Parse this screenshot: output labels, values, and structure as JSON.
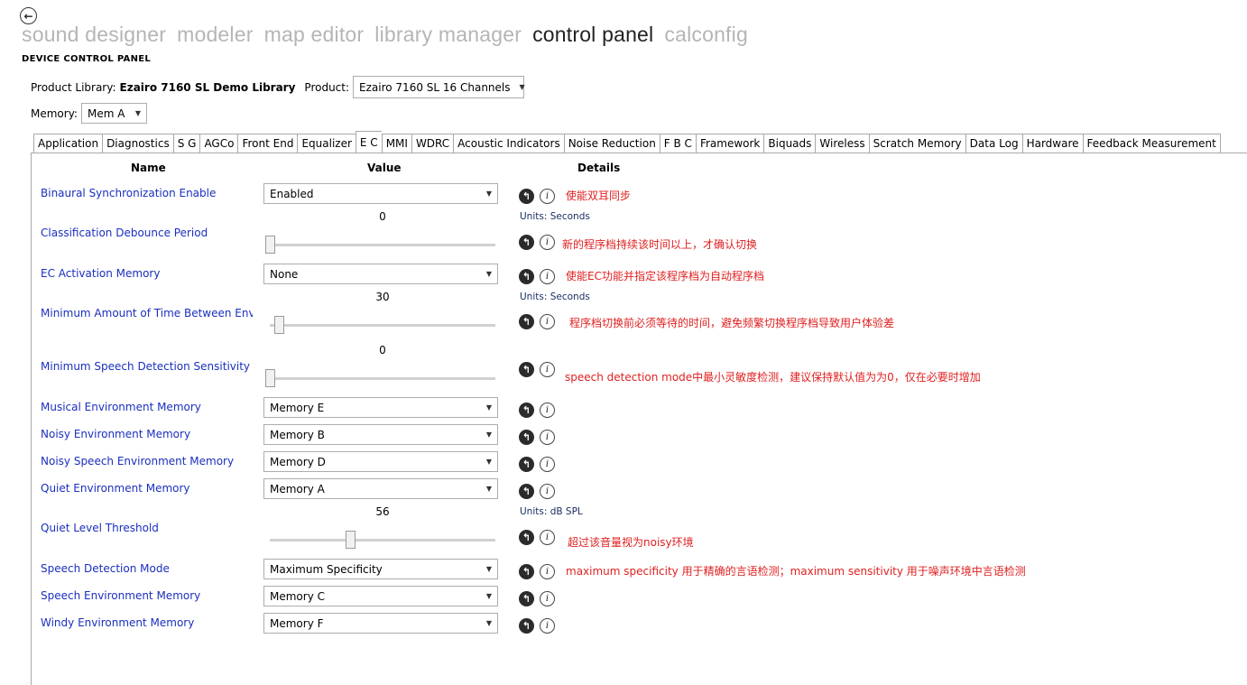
{
  "nav": {
    "back_icon": "back-arrow-icon",
    "items": [
      "sound designer",
      "modeler",
      "map editor",
      "library manager",
      "control panel",
      "calconfig"
    ],
    "active_index": 4
  },
  "page_title": "DEVICE CONTROL PANEL",
  "product_library": {
    "label": "Product Library:",
    "value": "Ezairo 7160 SL Demo Library"
  },
  "product": {
    "label": "Product:",
    "value": "Ezairo 7160 SL 16 Channels"
  },
  "memory": {
    "label": "Memory:",
    "value": "Mem A"
  },
  "tabs": [
    "Application",
    "Diagnostics",
    "S G",
    "AGCo",
    "Front End",
    "Equalizer",
    "E C",
    "MMI",
    "WDRC",
    "Acoustic Indicators",
    "Noise Reduction",
    "F B C",
    "Framework",
    "Biquads",
    "Wireless",
    "Scratch Memory",
    "Data Log",
    "Hardware",
    "Feedback Measurement"
  ],
  "active_tab": "E C",
  "columns": {
    "name": "Name",
    "value": "Value",
    "details": "Details"
  },
  "params": [
    {
      "name": "Binaural Synchronization Enable",
      "control": "dropdown",
      "value": "Enabled",
      "note": "使能双耳同步"
    },
    {
      "name": "Classification Debounce Period",
      "control": "slider",
      "value": "0",
      "units_label": "Units:",
      "units": "Seconds",
      "fraction": 0.0,
      "note": "新的程序档持续该时间以上，才确认切换"
    },
    {
      "name": "EC Activation Memory",
      "control": "dropdown",
      "value": "None",
      "note": "使能EC功能并指定该程序档为自动程序档"
    },
    {
      "name": "Minimum Amount of Time Between Envir",
      "control": "slider",
      "value": "30",
      "units_label": "Units:",
      "units": "Seconds",
      "fraction": 0.04,
      "note": "程序档切换前必须等待的时间，避免频繁切换程序档导致用户体验差"
    },
    {
      "name": "Minimum Speech Detection Sensitivity",
      "control": "slider",
      "value": "0",
      "fraction": 0.0,
      "note": "speech detection mode中最小灵敏度检测，建议保持默认值为为0，仅在必要时增加"
    },
    {
      "name": "Musical Environment Memory",
      "control": "dropdown",
      "value": "Memory E",
      "note": ""
    },
    {
      "name": "Noisy Environment Memory",
      "control": "dropdown",
      "value": "Memory B",
      "note": ""
    },
    {
      "name": "Noisy Speech Environment Memory",
      "control": "dropdown",
      "value": "Memory D",
      "note": ""
    },
    {
      "name": "Quiet Environment Memory",
      "control": "dropdown",
      "value": "Memory A",
      "note": ""
    },
    {
      "name": "Quiet Level Threshold",
      "control": "slider",
      "value": "56",
      "units_label": "Units:",
      "units": "dB SPL",
      "fraction": 0.356,
      "note": "超过该音量视为noisy环境"
    },
    {
      "name": "Speech Detection Mode",
      "control": "dropdown",
      "value": "Maximum Specificity",
      "note": "maximum specificity 用于精确的言语检测；maximum sensitivity 用于噪声环境中言语检测"
    },
    {
      "name": "Speech Environment Memory",
      "control": "dropdown",
      "value": "Memory C",
      "note": ""
    },
    {
      "name": "Windy Environment Memory",
      "control": "dropdown",
      "value": "Memory F",
      "note": ""
    }
  ],
  "icons": {
    "reset": "reset-icon",
    "info": "info-icon"
  },
  "colors": {
    "param_name": "#1a2fbd",
    "note": "#e02020",
    "units": "#1a2f63"
  }
}
